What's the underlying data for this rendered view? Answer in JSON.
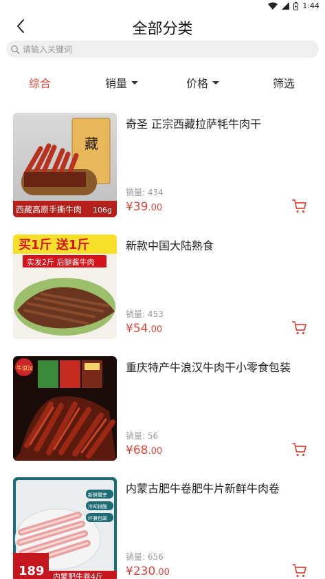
{
  "status": {
    "time": "1:44"
  },
  "header": {
    "title": "全部分类"
  },
  "search": {
    "placeholder": "请输入关键词"
  },
  "sort": {
    "items": [
      {
        "label": "综合"
      },
      {
        "label": "销量"
      },
      {
        "label": "价格"
      },
      {
        "label": "筛选"
      }
    ]
  },
  "products": [
    {
      "name": "奇圣 正宗西藏拉萨牦牛肉干",
      "sales_label": "销量:",
      "sales": "434",
      "currency": "¥",
      "price_int": "39",
      "price_dec": ".00",
      "thumb_text": "西藏高原手撕牛肉",
      "thumb_weight": "106g"
    },
    {
      "name": "新款中国大陆熟食",
      "sales_label": "销量:",
      "sales": "453",
      "currency": "¥",
      "price_int": "54",
      "price_dec": ".00",
      "thumb_banner": "买1斤 送1斤",
      "thumb_sub": "实发2斤 后腿酱牛肉"
    },
    {
      "name": "重庆特产牛浪汉牛肉干小零食包装",
      "sales_label": "销量:",
      "sales": "56",
      "currency": "¥",
      "price_int": "68",
      "price_dec": ".00",
      "thumb_brand": "牛浪汉"
    },
    {
      "name": "内蒙古肥牛卷肥牛片新鲜牛肉卷",
      "sales_label": "销量:",
      "sales": "656",
      "currency": "¥",
      "price_int": "230",
      "price_dec": ".00",
      "thumb_tags": [
        "新鲜屠宰",
        "冷却排酸",
        "坏兼包邮"
      ],
      "thumb_price": "189",
      "thumb_footer": "内蒙肥牛卷4斤"
    }
  ],
  "colors": {
    "accent": "#e0453b",
    "search_bg": "#efefef"
  }
}
